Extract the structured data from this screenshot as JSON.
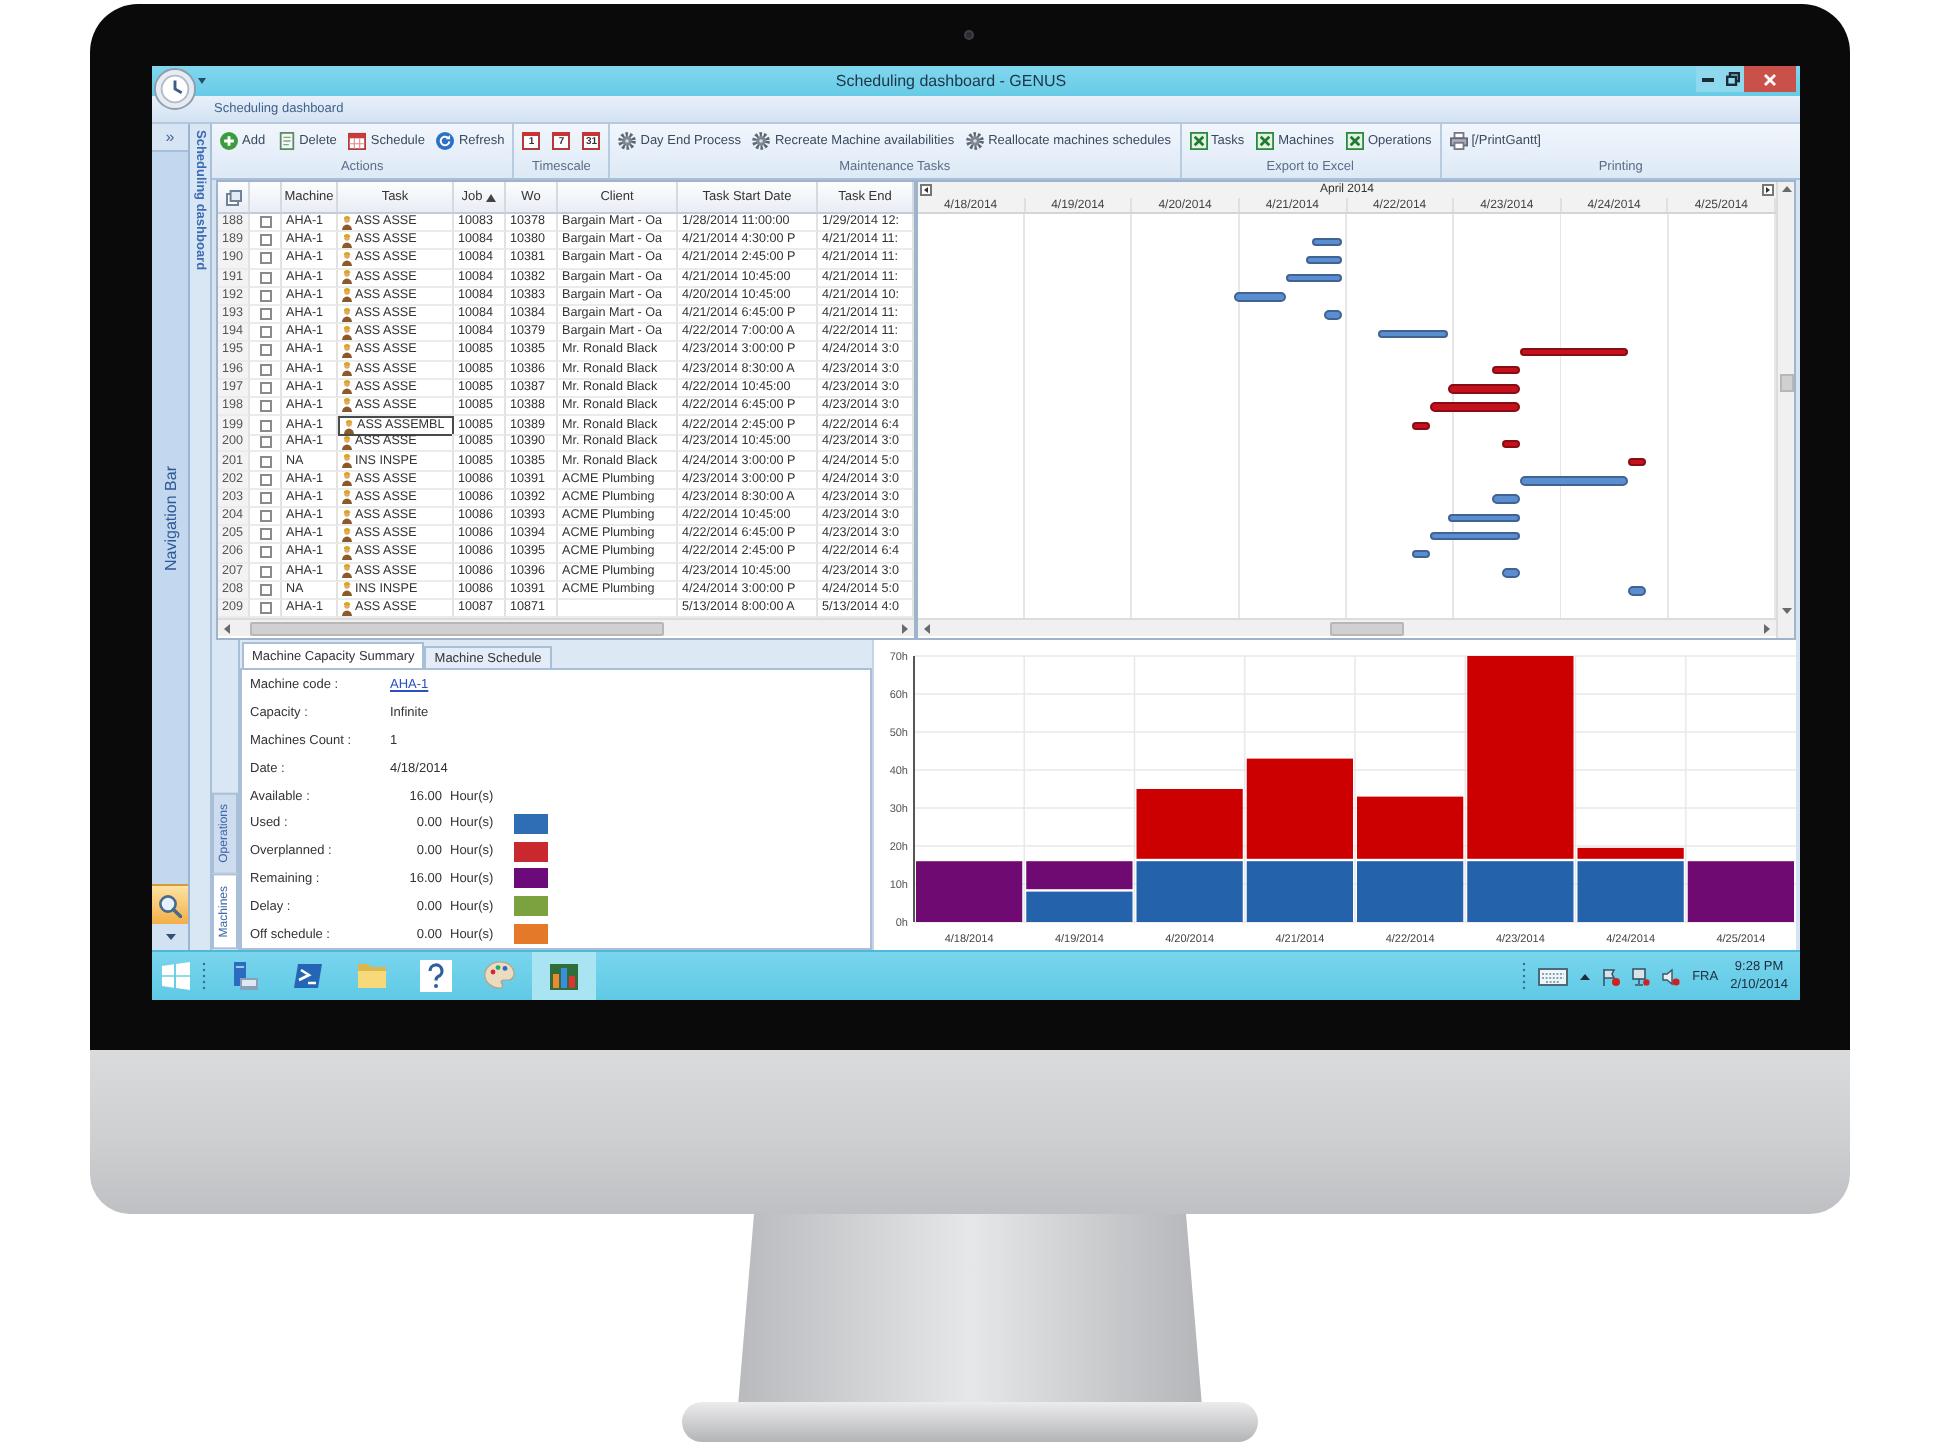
{
  "window": {
    "title": "Scheduling dashboard - GENUS"
  },
  "ribbon": {
    "tab": "Scheduling dashboard",
    "groups": [
      {
        "label": "Actions",
        "buttons": [
          {
            "kind": "add",
            "label": "Add"
          },
          {
            "kind": "delete",
            "label": "Delete"
          },
          {
            "kind": "schedule",
            "label": "Schedule"
          },
          {
            "kind": "refresh",
            "label": "Refresh"
          }
        ]
      },
      {
        "label": "Timescale",
        "buttons": [
          {
            "kind": "calendar",
            "label": "1"
          },
          {
            "kind": "calendar",
            "label": "7"
          },
          {
            "kind": "calendar",
            "label": "31"
          }
        ]
      },
      {
        "label": "Maintenance Tasks",
        "buttons": [
          {
            "kind": "process",
            "label": "Day End Process"
          },
          {
            "kind": "process",
            "label": "Recreate Machine availabilities"
          },
          {
            "kind": "process",
            "label": "Reallocate machines schedules"
          }
        ]
      },
      {
        "label": "Export to Excel",
        "buttons": [
          {
            "kind": "excel",
            "label": "Tasks"
          },
          {
            "kind": "excel",
            "label": "Machines"
          },
          {
            "kind": "excel",
            "label": "Operations"
          }
        ]
      },
      {
        "label": "Printing",
        "buttons": [
          {
            "kind": "print",
            "label": "[/PrintGantt]"
          }
        ]
      }
    ]
  },
  "navigation_bar": {
    "expand": "»",
    "label": "Navigation Bar"
  },
  "side_tab": {
    "label": "Scheduling dashboard"
  },
  "grid": {
    "columns": [
      {
        "label": "Machine",
        "sorted": false
      },
      {
        "label": "Task",
        "sorted": false
      },
      {
        "label": "Job",
        "sorted": true
      },
      {
        "label": "Wo",
        "sorted": false
      },
      {
        "label": "Client",
        "sorted": false
      },
      {
        "label": "Task Start Date",
        "sorted": false
      },
      {
        "label": "Task End",
        "sorted": false
      }
    ],
    "rows": [
      {
        "number": "188",
        "checked": false,
        "machine": "AHA-1",
        "task": "ASS ASSE",
        "editing": false,
        "job": "10083",
        "wo": "10378",
        "client": "Bargain Mart - Oa",
        "start": "1/28/2014 11:00:00",
        "end": "1/29/2014 12:"
      },
      {
        "number": "189",
        "checked": false,
        "machine": "AHA-1",
        "task": "ASS ASSE",
        "editing": false,
        "job": "10084",
        "wo": "10380",
        "client": "Bargain Mart - Oa",
        "start": "4/21/2014 4:30:00 P",
        "end": "4/21/2014 11:"
      },
      {
        "number": "190",
        "checked": false,
        "machine": "AHA-1",
        "task": "ASS ASSE",
        "editing": false,
        "job": "10084",
        "wo": "10381",
        "client": "Bargain Mart - Oa",
        "start": "4/21/2014 2:45:00 P",
        "end": "4/21/2014 11:"
      },
      {
        "number": "191",
        "checked": false,
        "machine": "AHA-1",
        "task": "ASS ASSE",
        "editing": false,
        "job": "10084",
        "wo": "10382",
        "client": "Bargain Mart - Oa",
        "start": "4/21/2014 10:45:00",
        "end": "4/21/2014 11:"
      },
      {
        "number": "192",
        "checked": false,
        "machine": "AHA-1",
        "task": "ASS ASSE",
        "editing": false,
        "job": "10084",
        "wo": "10383",
        "client": "Bargain Mart - Oa",
        "start": "4/20/2014 10:45:00",
        "end": "4/21/2014 10:"
      },
      {
        "number": "193",
        "checked": false,
        "machine": "AHA-1",
        "task": "ASS ASSE",
        "editing": false,
        "job": "10084",
        "wo": "10384",
        "client": "Bargain Mart - Oa",
        "start": "4/21/2014 6:45:00 P",
        "end": "4/21/2014 11:"
      },
      {
        "number": "194",
        "checked": false,
        "machine": "AHA-1",
        "task": "ASS ASSE",
        "editing": false,
        "job": "10084",
        "wo": "10379",
        "client": "Bargain Mart - Oa",
        "start": "4/22/2014 7:00:00 A",
        "end": "4/22/2014 11:"
      },
      {
        "number": "195",
        "checked": false,
        "machine": "AHA-1",
        "task": "ASS ASSE",
        "editing": false,
        "job": "10085",
        "wo": "10385",
        "client": "Mr. Ronald Black",
        "start": "4/23/2014 3:00:00 P",
        "end": "4/24/2014 3:0"
      },
      {
        "number": "196",
        "checked": false,
        "machine": "AHA-1",
        "task": "ASS ASSE",
        "editing": false,
        "job": "10085",
        "wo": "10386",
        "client": "Mr. Ronald Black",
        "start": "4/23/2014 8:30:00 A",
        "end": "4/23/2014 3:0"
      },
      {
        "number": "197",
        "checked": false,
        "machine": "AHA-1",
        "task": "ASS ASSE",
        "editing": false,
        "job": "10085",
        "wo": "10387",
        "client": "Mr. Ronald Black",
        "start": "4/22/2014 10:45:00",
        "end": "4/23/2014 3:0"
      },
      {
        "number": "198",
        "checked": false,
        "machine": "AHA-1",
        "task": "ASS ASSE",
        "editing": false,
        "job": "10085",
        "wo": "10388",
        "client": "Mr. Ronald Black",
        "start": "4/22/2014 6:45:00 P",
        "end": "4/23/2014 3:0"
      },
      {
        "number": "199",
        "checked": false,
        "machine": "AHA-1",
        "task": "ASS ASSEMBL",
        "editing": true,
        "job": "10085",
        "wo": "10389",
        "client": "Mr. Ronald Black",
        "start": "4/22/2014 2:45:00 P",
        "end": "4/22/2014 6:4"
      },
      {
        "number": "200",
        "checked": false,
        "machine": "AHA-1",
        "task": "ASS ASSE",
        "editing": false,
        "job": "10085",
        "wo": "10390",
        "client": "Mr. Ronald Black",
        "start": "4/23/2014 10:45:00",
        "end": "4/23/2014 3:0"
      },
      {
        "number": "201",
        "checked": false,
        "machine": "NA",
        "task": "INS INSPE",
        "editing": false,
        "job": "10085",
        "wo": "10385",
        "client": "Mr. Ronald Black",
        "start": "4/24/2014 3:00:00 P",
        "end": "4/24/2014 5:0"
      },
      {
        "number": "202",
        "checked": false,
        "machine": "AHA-1",
        "task": "ASS ASSE",
        "editing": false,
        "job": "10086",
        "wo": "10391",
        "client": "ACME Plumbing",
        "start": "4/23/2014 3:00:00 P",
        "end": "4/24/2014 3:0"
      },
      {
        "number": "203",
        "checked": false,
        "machine": "AHA-1",
        "task": "ASS ASSE",
        "editing": false,
        "job": "10086",
        "wo": "10392",
        "client": "ACME Plumbing",
        "start": "4/23/2014 8:30:00 A",
        "end": "4/23/2014 3:0"
      },
      {
        "number": "204",
        "checked": false,
        "machine": "AHA-1",
        "task": "ASS ASSE",
        "editing": false,
        "job": "10086",
        "wo": "10393",
        "client": "ACME Plumbing",
        "start": "4/22/2014 10:45:00",
        "end": "4/23/2014 3:0"
      },
      {
        "number": "205",
        "checked": false,
        "machine": "AHA-1",
        "task": "ASS ASSE",
        "editing": false,
        "job": "10086",
        "wo": "10394",
        "client": "ACME Plumbing",
        "start": "4/22/2014 6:45:00 P",
        "end": "4/23/2014 3:0"
      },
      {
        "number": "206",
        "checked": false,
        "machine": "AHA-1",
        "task": "ASS ASSE",
        "editing": false,
        "job": "10086",
        "wo": "10395",
        "client": "ACME Plumbing",
        "start": "4/22/2014 2:45:00 P",
        "end": "4/22/2014 6:4"
      },
      {
        "number": "207",
        "checked": false,
        "machine": "AHA-1",
        "task": "ASS ASSE",
        "editing": false,
        "job": "10086",
        "wo": "10396",
        "client": "ACME Plumbing",
        "start": "4/23/2014 10:45:00",
        "end": "4/23/2014 3:0"
      },
      {
        "number": "208",
        "checked": false,
        "machine": "NA",
        "task": "INS INSPE",
        "editing": false,
        "job": "10086",
        "wo": "10391",
        "client": "ACME Plumbing",
        "start": "4/24/2014 3:00:00 P",
        "end": "4/24/2014 5:0"
      },
      {
        "number": "209",
        "checked": false,
        "machine": "AHA-1",
        "task": "ASS ASSE",
        "editing": false,
        "job": "10087",
        "wo": "10871",
        "start": "5/13/2014 8:00:00 A",
        "end": "5/13/2014 4:0"
      }
    ]
  },
  "gantt": {
    "month": "April 2014",
    "days": [
      "4/18/2014",
      "4/19/2014",
      "4/20/2014",
      "4/21/2014",
      "4/22/2014",
      "4/23/2014",
      "4/24/2014",
      "4/25/2014"
    ],
    "bars": [
      {
        "color": "#5b8ed0"
      },
      {
        "color": "#5b8ed0"
      },
      {
        "color": "#5b8ed0"
      },
      {
        "color": "#5b8ed0"
      },
      {
        "color": "#5b8ed0"
      },
      {
        "color": "#5b8ed0"
      },
      {
        "color": "#c4111d"
      },
      {
        "color": "#c4111d"
      },
      {
        "color": "#c4111d"
      },
      {
        "color": "#c4111d"
      },
      {
        "color": "#c4111d"
      },
      {
        "color": "#c4111d"
      },
      {
        "color": "#c4111d"
      },
      {
        "color": "#5b8ed0"
      },
      {
        "color": "#5b8ed0"
      },
      {
        "color": "#5b8ed0"
      },
      {
        "color": "#5b8ed0"
      },
      {
        "color": "#5b8ed0"
      },
      {
        "color": "#5b8ed0"
      },
      {
        "color": "#5b8ed0"
      }
    ]
  },
  "details": {
    "side_tabs": [
      {
        "label": "Operations",
        "selected": false
      },
      {
        "label": "Machines",
        "selected": true
      }
    ],
    "tabs": [
      {
        "label": "Machine Capacity Summary",
        "selected": true
      },
      {
        "label": "Machine Schedule",
        "selected": false
      }
    ],
    "fields": [
      {
        "kind": "link",
        "label": "Machine code :",
        "value": "AHA-1"
      },
      {
        "kind": "text",
        "label": "Capacity :",
        "value": "Infinite"
      },
      {
        "kind": "text",
        "label": "Machines Count :",
        "value": "1"
      },
      {
        "kind": "text",
        "label": "Date :",
        "value": "4/18/2014"
      },
      {
        "kind": "hours",
        "label": "Available :",
        "value": "16.00",
        "unit": "Hour(s)"
      },
      {
        "kind": "hours",
        "label": "Used :",
        "value": "0.00",
        "unit": "Hour(s)",
        "color": "#2f6db5"
      },
      {
        "kind": "hours",
        "label": "Overplanned :",
        "value": "0.00",
        "unit": "Hour(s)",
        "color": "#c8282e"
      },
      {
        "kind": "hours",
        "label": "Remaining :",
        "value": "16.00",
        "unit": "Hour(s)",
        "color": "#6b0a78"
      },
      {
        "kind": "hours",
        "label": "Delay :",
        "value": "0.00",
        "unit": "Hour(s)",
        "color": "#7ba23f"
      },
      {
        "kind": "hours",
        "label": "Off schedule :",
        "value": "0.00",
        "unit": "Hour(s)",
        "color": "#e5792a"
      }
    ]
  },
  "capacity_chart": {
    "chart_data": {
      "type": "bar",
      "stacked": true,
      "grid": true,
      "categories": [
        "4/18/2014",
        "4/19/2014",
        "4/20/2014",
        "4/21/2014",
        "4/22/2014",
        "4/23/2014",
        "4/24/2014",
        "4/25/2014"
      ],
      "series": [
        {
          "color": "#2462ab",
          "values": [
            0,
            8,
            16,
            16,
            16,
            16,
            16,
            0
          ]
        },
        {
          "color": "#6e0a72",
          "values": [
            16,
            8,
            0,
            0,
            0,
            0,
            0,
            16
          ]
        },
        {
          "color": "#cc0000",
          "values": [
            0,
            0,
            19,
            27,
            17,
            54,
            3.5,
            0
          ]
        }
      ],
      "ylim": [
        0,
        70
      ],
      "yticks": [
        {
          "value": 0,
          "label": "0h"
        },
        {
          "value": 10,
          "label": "10h"
        },
        {
          "value": 20,
          "label": "20h"
        },
        {
          "value": 30,
          "label": "30h"
        },
        {
          "value": 40,
          "label": "40h"
        },
        {
          "value": 50,
          "label": "50h"
        },
        {
          "value": 60,
          "label": "60h"
        },
        {
          "value": 70,
          "label": "70h"
        }
      ]
    }
  },
  "taskbar": {
    "apps": [
      {
        "kind": "server",
        "active": false
      },
      {
        "kind": "terminal",
        "active": false
      },
      {
        "kind": "folder",
        "active": false
      },
      {
        "kind": "help",
        "active": false
      },
      {
        "kind": "paint",
        "active": false
      },
      {
        "kind": "colors",
        "active": true
      }
    ],
    "language": "FRA",
    "time": "9:28 PM",
    "date": "2/10/2014"
  }
}
